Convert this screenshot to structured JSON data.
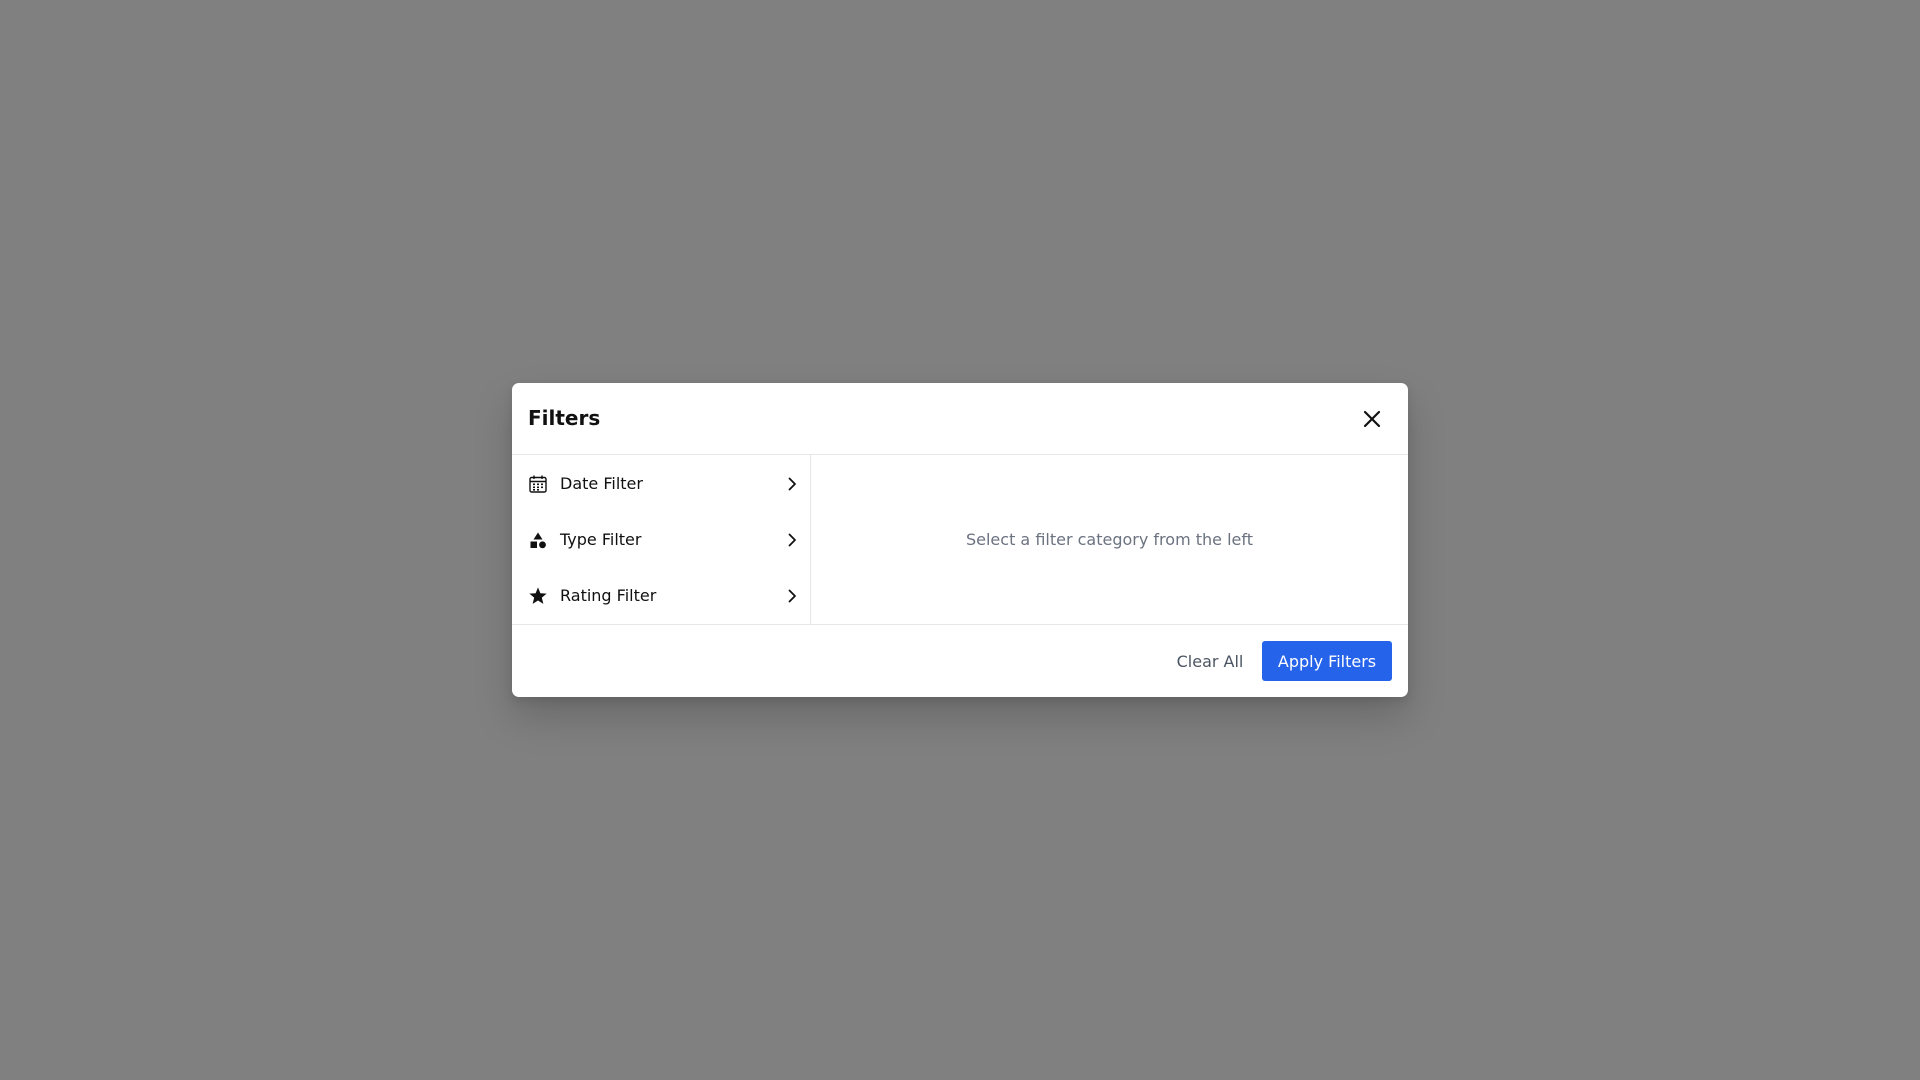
{
  "modal": {
    "title": "Filters",
    "close_icon": "close-icon"
  },
  "sidebar": {
    "items": [
      {
        "label": "Date Filter",
        "icon": "calendar-icon"
      },
      {
        "label": "Type Filter",
        "icon": "shapes-icon"
      },
      {
        "label": "Rating Filter",
        "icon": "star-icon"
      }
    ]
  },
  "content": {
    "placeholder": "Select a filter category from the left"
  },
  "footer": {
    "clear_label": "Clear All",
    "apply_label": "Apply Filters"
  },
  "colors": {
    "overlay": "#808080",
    "accent": "#2563eb",
    "muted_text": "#6b7280"
  }
}
